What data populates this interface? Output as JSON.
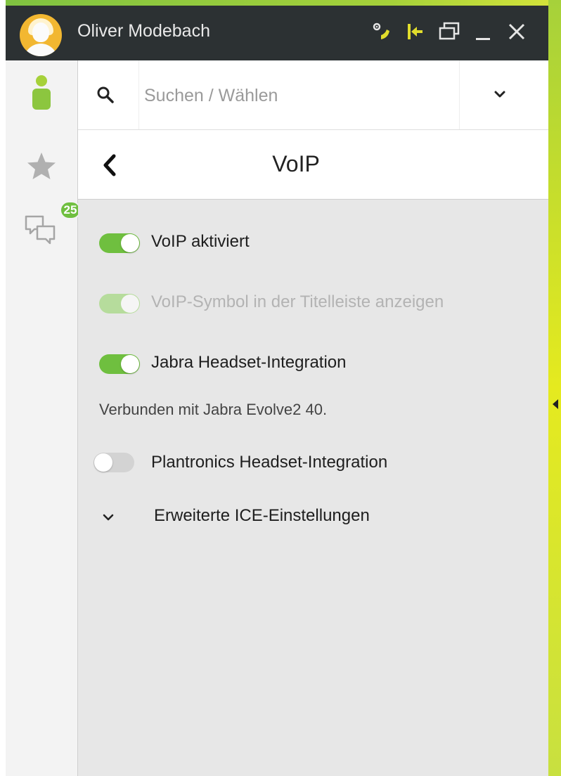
{
  "user": {
    "name": "Oliver Modebach"
  },
  "titlebar": {
    "icons": [
      "voip-settings-icon",
      "dock-icon",
      "window-restore-icon",
      "minimize-icon",
      "close-icon"
    ]
  },
  "sidebar": {
    "items": [
      {
        "icon": "contacts-icon",
        "active": true
      },
      {
        "icon": "favorites-star-icon"
      },
      {
        "icon": "chat-icon",
        "badge": "25"
      }
    ]
  },
  "search": {
    "placeholder": "Suchen / Wählen",
    "value": ""
  },
  "header": {
    "title": "VoIP"
  },
  "settings": {
    "voip_enabled": {
      "label": "VoIP aktiviert",
      "on": true
    },
    "voip_symbol": {
      "label": "VoIP-Symbol in der Titelleiste anzeigen",
      "on": true,
      "disabled": true
    },
    "jabra": {
      "label": "Jabra Headset-Integration",
      "on": true,
      "status": "Verbunden mit Jabra Evolve2 40."
    },
    "plantronics": {
      "label": "Plantronics Headset-Integration",
      "on": false
    },
    "ice": {
      "label": "Erweiterte ICE-Einstellungen",
      "expanded": false
    }
  },
  "colors": {
    "accent_green": "#6fbf3f",
    "titlebar_bg": "#2c3133",
    "frame_yellow_green": "#d6e43a",
    "content_bg": "#e7e7e7"
  }
}
